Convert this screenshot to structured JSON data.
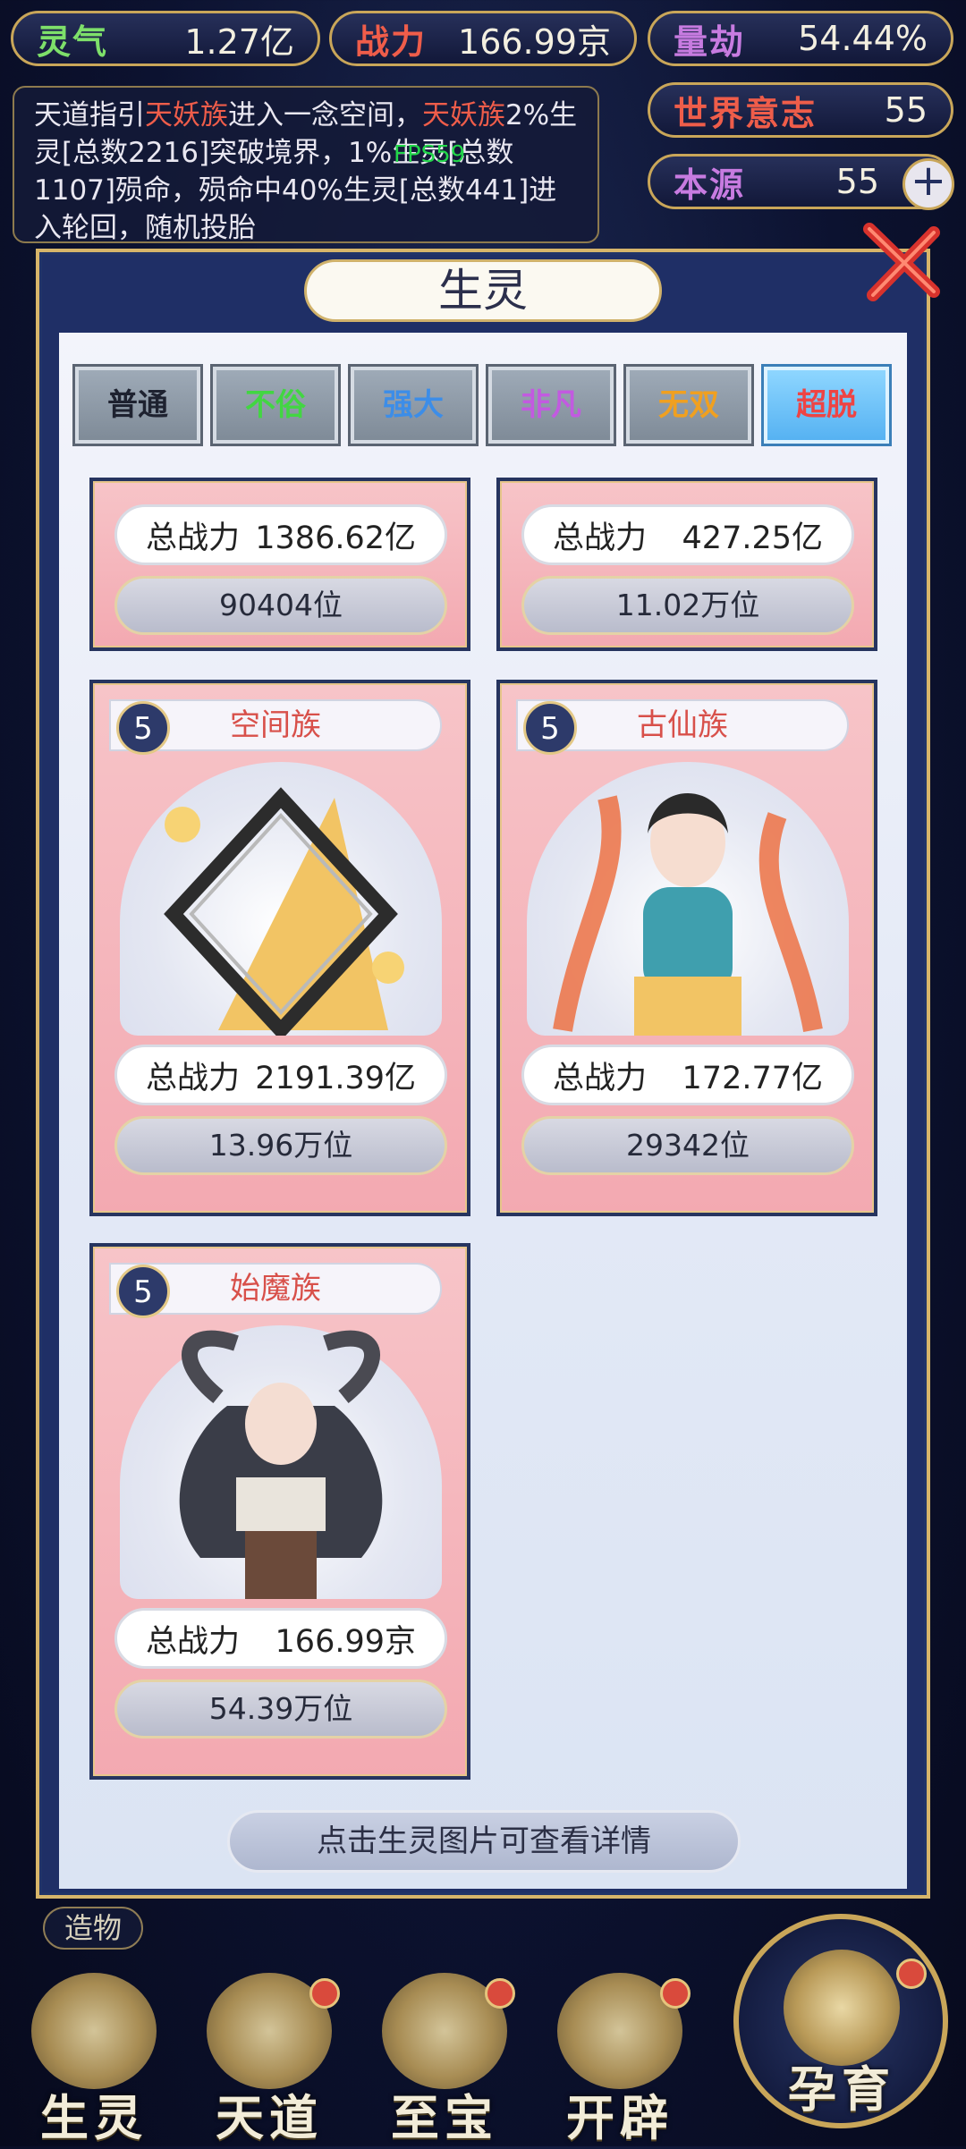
{
  "stats": {
    "lingqi": {
      "label": "灵气",
      "value": "1.27亿",
      "color": "#7ee06a"
    },
    "zhanli": {
      "label": "战力",
      "value": "166.99京",
      "color": "#ef5d4a"
    },
    "liangjie": {
      "label": "量劫",
      "value": "54.44%",
      "color": "#c77be0"
    },
    "world_will": {
      "label": "世界意志",
      "value": "55",
      "color": "#ef5d4a"
    },
    "origin": {
      "label": "本源",
      "value": "55",
      "color": "#c77be0"
    }
  },
  "message": {
    "part1": "天道指引",
    "race1": "天妖族",
    "part2": "进入一念空间，",
    "race2": "天妖族",
    "part3": "2%生灵[总数2216]突破境界，1%生灵[总数1107]殒命，殒命中40%生灵[总数441]进入轮回，随机投胎"
  },
  "fps": "FPS59",
  "modal": {
    "title": "生灵",
    "tabs": [
      {
        "label": "普通",
        "color": "#1e2230"
      },
      {
        "label": "不俗",
        "color": "#42d642"
      },
      {
        "label": "强大",
        "color": "#3c8de8"
      },
      {
        "label": "非凡",
        "color": "#c25ae0"
      },
      {
        "label": "无双",
        "color": "#f0a020"
      },
      {
        "label": "超脱",
        "color": "#ee4444"
      }
    ],
    "power_label": "总战力",
    "cards": [
      {
        "level": "",
        "name": "",
        "power": "1386.62亿",
        "rank": "90404位"
      },
      {
        "level": "",
        "name": "",
        "power": "427.25亿",
        "rank": "11.02万位"
      },
      {
        "level": "5",
        "name": "空间族",
        "power": "2191.39亿",
        "rank": "13.96万位"
      },
      {
        "level": "5",
        "name": "古仙族",
        "power": "172.77亿",
        "rank": "29342位"
      },
      {
        "level": "5",
        "name": "始魔族",
        "power": "166.99京",
        "rank": "54.39万位"
      }
    ],
    "hint": "点击生灵图片可查看详情"
  },
  "side_label": "造物",
  "nav": [
    {
      "label": "生灵"
    },
    {
      "label": "天道"
    },
    {
      "label": "至宝"
    },
    {
      "label": "开辟"
    },
    {
      "label": "孕育"
    }
  ]
}
